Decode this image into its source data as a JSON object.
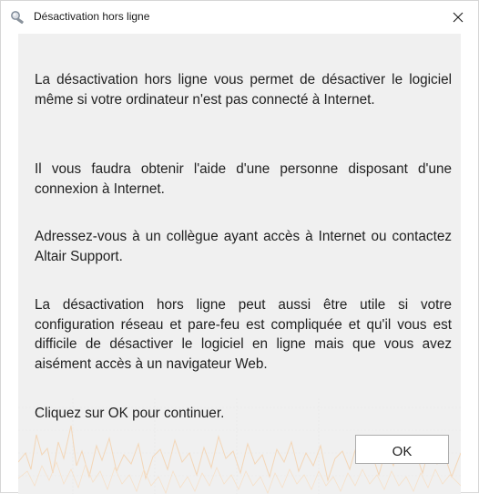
{
  "window": {
    "title": "Désactivation hors ligne"
  },
  "titlebar": {
    "icon": "magnifier-key-icon",
    "close_icon": "close-icon"
  },
  "body": {
    "paragraphs": [
      "La désactivation hors ligne vous permet de désactiver le logiciel même si votre ordinateur n'est pas connecté à Internet.",
      "Il vous faudra obtenir l'aide d'une personne disposant d'une connexion à Internet.",
      "Adressez-vous à un collègue ayant accès à Internet ou contactez Altair Support.",
      "La désactivation hors ligne peut aussi être utile si votre configuration réseau et pare-feu est compliquée et qu'il vous est difficile de désactiver le logiciel en ligne mais que vous avez aisément accès à un navigateur Web.",
      "Cliquez sur OK pour continuer."
    ]
  },
  "buttons": {
    "ok_label": "OK"
  },
  "colors": {
    "content_background": "#f0f0f0",
    "titlebar_background": "#ffffff",
    "background_graph_line": "#f2d2b0",
    "background_graph_grid": "#e4e4e4"
  }
}
